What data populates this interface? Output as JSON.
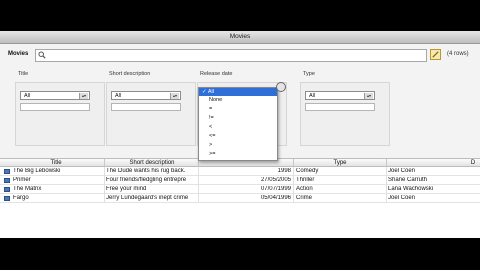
{
  "window": {
    "title": "Movies"
  },
  "search": {
    "label": "Movies",
    "value": "",
    "rows_count": "(4 rows)"
  },
  "filters": [
    {
      "label": "Title",
      "selected": "All"
    },
    {
      "label": "Short description",
      "selected": "All"
    },
    {
      "label": "Release date",
      "selected": "All"
    },
    {
      "label": "Type",
      "selected": "All"
    }
  ],
  "dropdown": {
    "options": [
      "All",
      "None",
      "=",
      "!=",
      "<",
      "<=",
      ">",
      ">="
    ],
    "selected": "All"
  },
  "table": {
    "columns": [
      "Title",
      "Short description",
      "",
      "Type",
      "D"
    ],
    "rows": [
      [
        "The Big Lebowski",
        "The Dude wants his rug back.",
        "1998",
        "Comedy",
        "Joel Coen"
      ],
      [
        "Primer",
        "Four friends/fledgling entrepre",
        "27/05/2005",
        "Thriller",
        "Shane Carruth"
      ],
      [
        "The Matrix",
        "Free your mind",
        "07/07/1999",
        "Action",
        "Lana Wachowski"
      ],
      [
        "Fargo",
        "Jerry Lundegaard's inept crime",
        "05/04/1996",
        "Crime",
        "Joel Coen"
      ]
    ]
  },
  "colors": {
    "selection": "#2f6fd8",
    "row_icon": "#4a78b8"
  }
}
